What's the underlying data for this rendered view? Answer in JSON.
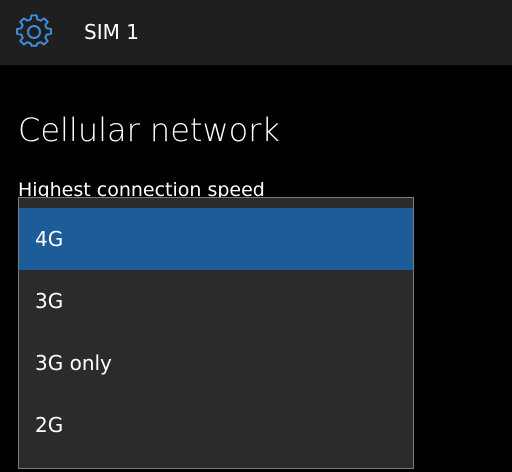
{
  "header": {
    "icon": "gear-icon",
    "title": "SIM 1"
  },
  "page": {
    "title": "Cellular network",
    "setting_label": "Highest connection speed"
  },
  "dropdown": {
    "selected_index": 0,
    "accent_color": "#1c5d99",
    "options": [
      {
        "label": "4G"
      },
      {
        "label": "3G"
      },
      {
        "label": "3G only"
      },
      {
        "label": "2G"
      }
    ]
  }
}
